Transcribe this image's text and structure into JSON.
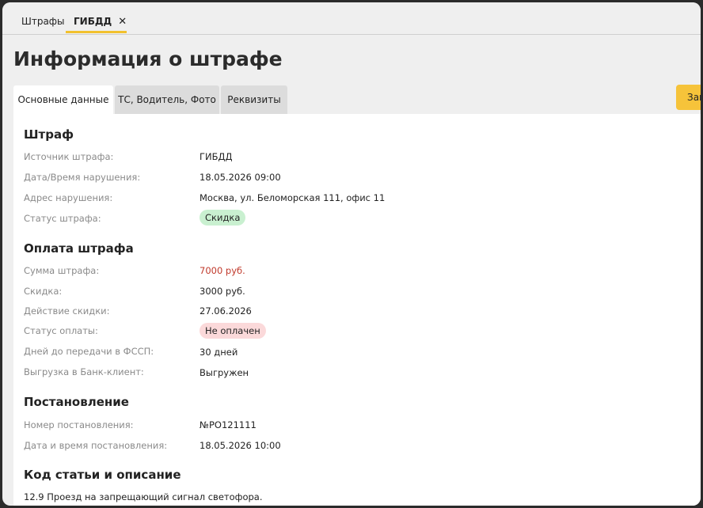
{
  "top_tabs": [
    {
      "label": "Штрафы"
    },
    {
      "label": "ГИБДД",
      "close": "✕"
    }
  ],
  "page_title": "Информация о штрафе",
  "tabs": [
    {
      "label": "Основные данные"
    },
    {
      "label": "ТС, Водитель, Фото"
    },
    {
      "label": "Реквизиты"
    }
  ],
  "action_button_label": "Зак",
  "sections": {
    "fine": {
      "title": "Штраф",
      "source_label": "Источник штрафа:",
      "source_value": "ГИБДД",
      "datetime_label": "Дата/Время нарушения:",
      "datetime_value": "18.05.2026 09:00",
      "address_label": "Адрес нарушения:",
      "address_value": "Москва, ул. Беломорская 111, офис 11",
      "status_label": "Статус штрафа:",
      "status_value": "Скидка"
    },
    "payment": {
      "title": "Оплата штрафа",
      "amount_label": "Сумма штрафа:",
      "amount_value": "7000 руб.",
      "discount_label": "Скидка:",
      "discount_value": "3000 руб.",
      "discount_valid_label": "Действие скидки:",
      "discount_valid_value": "27.06.2026",
      "pay_status_label": "Статус оплаты:",
      "pay_status_value": "Не оплачен",
      "fssp_label": "Дней до передачи в ФССП:",
      "fssp_value": "30 дней",
      "bank_label": "Выгрузка в Банк-клиент:",
      "bank_value": "Выгружен"
    },
    "resolution": {
      "title": "Постановление",
      "number_label": "Номер постановления:",
      "number_value": "№РО121111",
      "date_label": "Дата и время постановления:",
      "date_value": "18.05.2026 10:00"
    },
    "article": {
      "title": "Код статьи и описание",
      "text": "12.9 Проезд на запрещающий сигнал светофора."
    }
  },
  "colors": {
    "accent": "#f2c12e",
    "amount_red": "#c0392b",
    "badge_green": "#c9f0d0",
    "badge_pink": "#fbd9da"
  }
}
